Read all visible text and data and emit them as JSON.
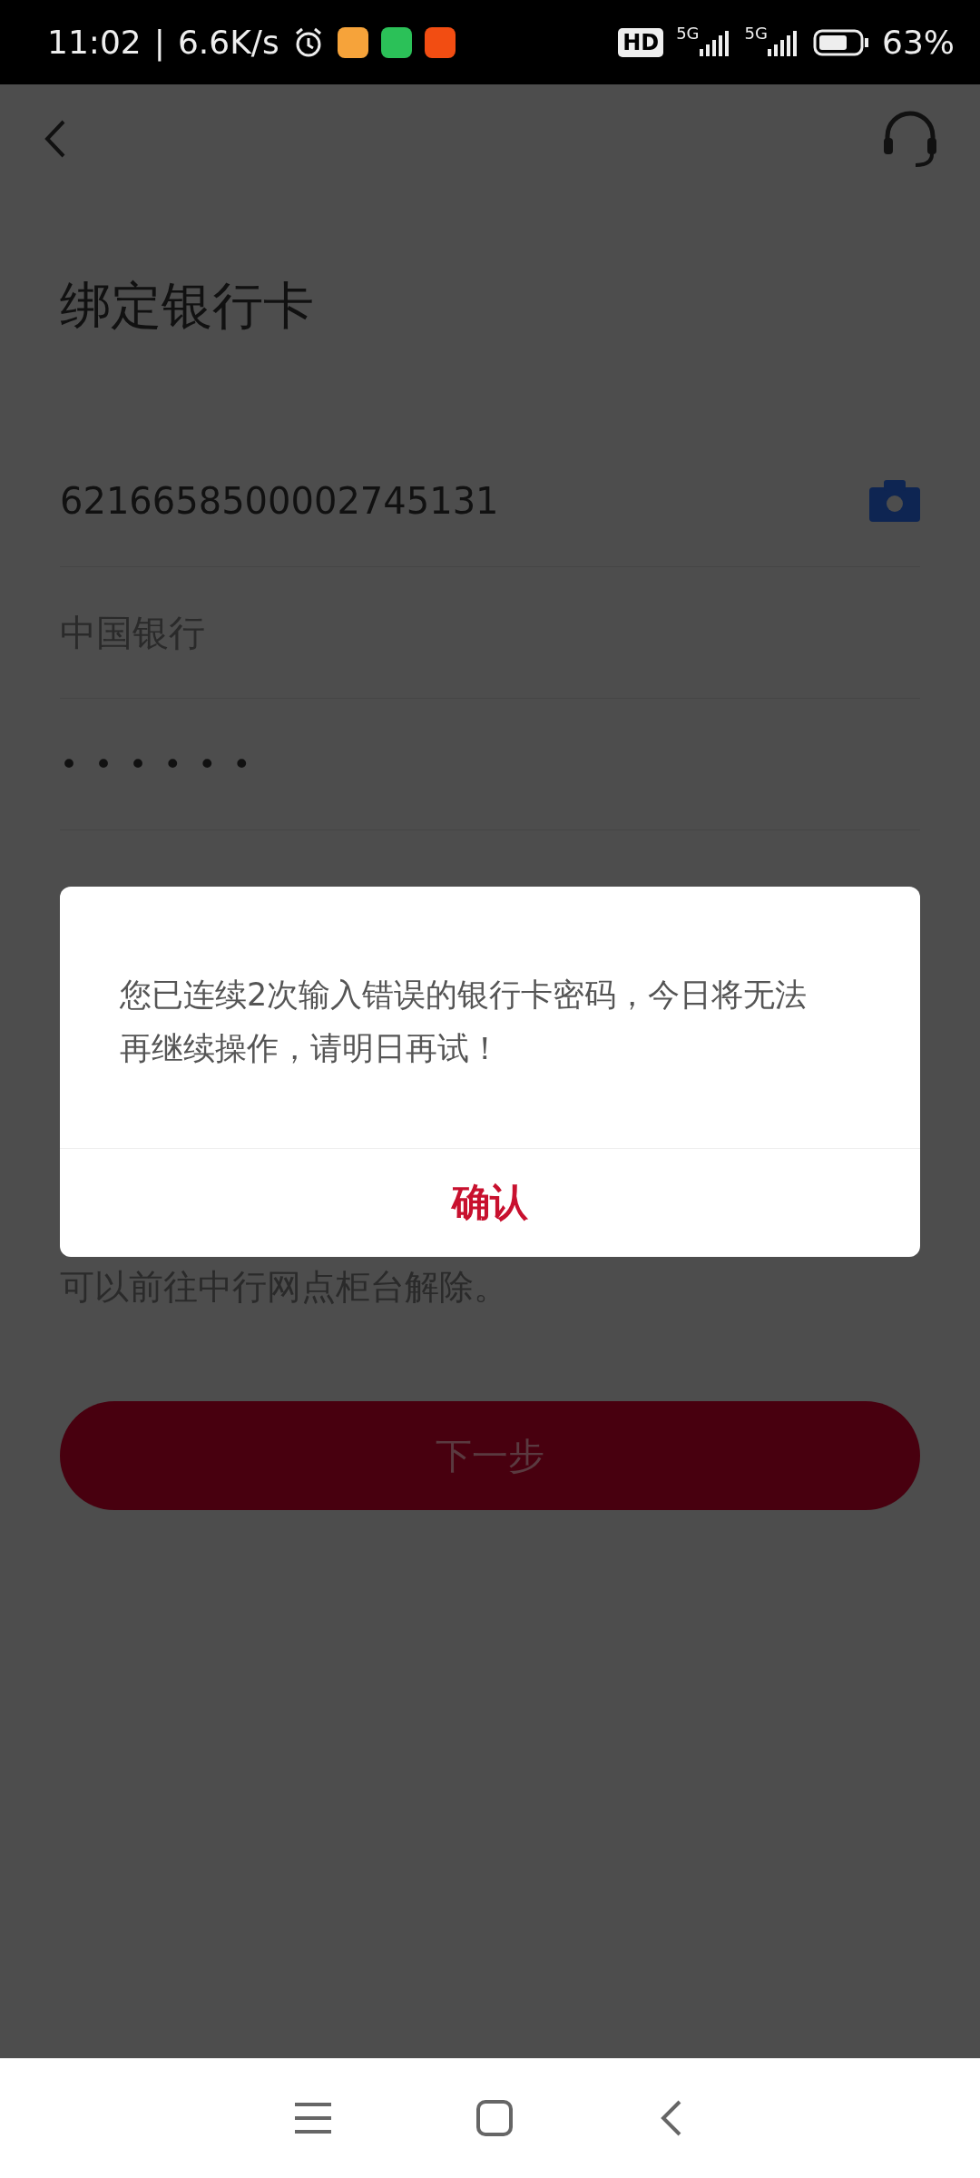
{
  "status_bar": {
    "time": "11:02",
    "separator": "|",
    "speed": "6.6K/s",
    "hd": "HD",
    "networks": [
      "5G",
      "5G"
    ],
    "battery": "63%"
  },
  "title": "绑定银行卡",
  "fields": [
    {
      "kind": "card",
      "value": "6216658500002745131"
    },
    {
      "kind": "bank",
      "value": "中国银行"
    },
    {
      "kind": "password",
      "value": "••••••"
    }
  ],
  "note": "可以前往中行网点柜台解除。",
  "next_button": {
    "label": "下一步",
    "disabled": true
  },
  "dialog": {
    "message": "您已连续2次输入错误的银行卡密码，今日将无法再继续操作，请明日再试！",
    "confirm": "确认"
  }
}
